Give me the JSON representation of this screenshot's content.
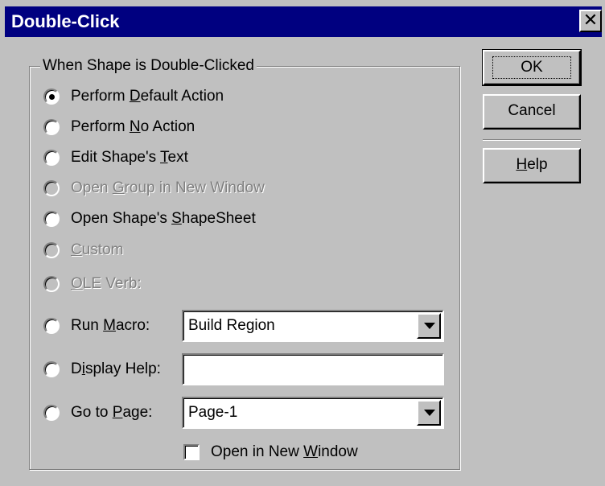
{
  "window": {
    "title": "Double-Click",
    "close_glyph": "✕"
  },
  "group": {
    "label": "When Shape is Double-Clicked"
  },
  "options": {
    "default_action": {
      "pre": "Perform ",
      "key": "D",
      "post": "efault Action",
      "checked": true
    },
    "no_action": {
      "pre": "Perform ",
      "key": "N",
      "post": "o Action"
    },
    "edit_text": {
      "pre": "Edit Shape's ",
      "key": "T",
      "post": "ext"
    },
    "open_group": {
      "pre": "Open ",
      "key": "G",
      "post": "roup in New Window",
      "disabled": true
    },
    "open_shapesheet": {
      "pre": "Open Shape's ",
      "key": "S",
      "post": "hapeSheet"
    },
    "custom": {
      "pre": "",
      "key": "C",
      "post": "ustom",
      "disabled": true
    },
    "ole_verb": {
      "pre": "",
      "key": "O",
      "post": "LE Verb:",
      "disabled": true
    },
    "run_macro": {
      "pre": "Run ",
      "key": "M",
      "post": "acro:"
    },
    "display_help": {
      "pre": "D",
      "key": "i",
      "post": "splay Help:"
    },
    "go_to_page": {
      "pre": "Go to ",
      "key": "P",
      "post": "age:"
    }
  },
  "fields": {
    "macro_value": "Build Region",
    "help_value": "",
    "page_value": "Page-1"
  },
  "checkbox": {
    "pre": "Open in New ",
    "key": "W",
    "post": "indow",
    "checked": false
  },
  "buttons": {
    "ok": "OK",
    "cancel": "Cancel",
    "help_key": "H",
    "help_post": "elp"
  }
}
